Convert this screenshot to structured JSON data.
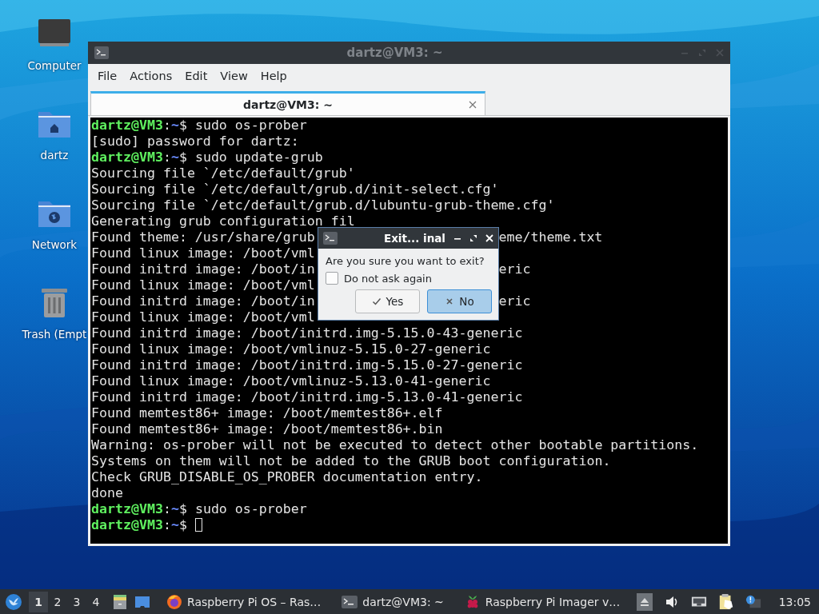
{
  "desktop_icons": [
    {
      "label": "Computer",
      "kind": "computer"
    },
    {
      "label": "dartz",
      "kind": "home"
    },
    {
      "label": "Network",
      "kind": "network"
    },
    {
      "label": "Trash (Empt",
      "kind": "trash"
    }
  ],
  "terminal_window": {
    "title": "dartz@VM3: ~",
    "menu": [
      "File",
      "Actions",
      "Edit",
      "View",
      "Help"
    ],
    "tabs": [
      {
        "label": "dartz@VM3: ~",
        "selected": true
      }
    ],
    "lines": [
      {
        "kind": "prompt",
        "parts": [
          "dartz@VM3",
          ":",
          "~",
          "$ sudo os-prober"
        ]
      },
      {
        "kind": "output",
        "text": "[sudo] password for dartz:"
      },
      {
        "kind": "prompt",
        "parts": [
          "dartz@VM3",
          ":",
          "~",
          "$ sudo update-grub"
        ]
      },
      {
        "kind": "output",
        "text": "Sourcing file `/etc/default/grub'"
      },
      {
        "kind": "output",
        "text": "Sourcing file `/etc/default/grub.d/init-select.cfg'"
      },
      {
        "kind": "output",
        "text": "Sourcing file `/etc/default/grub.d/lubuntu-grub-theme.cfg'"
      },
      {
        "kind": "output",
        "text": "Generating grub configuration fil"
      },
      {
        "kind": "split",
        "left": "Found theme: /usr/share/grub",
        "right": "eme/theme.txt"
      },
      {
        "kind": "output",
        "text": "Found linux image: /boot/vml"
      },
      {
        "kind": "split",
        "left": "Found initrd image: /boot/in",
        "right": "eric"
      },
      {
        "kind": "output",
        "text": "Found linux image: /boot/vml"
      },
      {
        "kind": "split",
        "left": "Found initrd image: /boot/in",
        "right": "eric"
      },
      {
        "kind": "output",
        "text": "Found linux image: /boot/vml"
      },
      {
        "kind": "output",
        "text": "Found initrd image: /boot/initrd.img-5.15.0-43-generic"
      },
      {
        "kind": "output",
        "text": "Found linux image: /boot/vmlinuz-5.15.0-27-generic"
      },
      {
        "kind": "output",
        "text": "Found initrd image: /boot/initrd.img-5.15.0-27-generic"
      },
      {
        "kind": "output",
        "text": "Found linux image: /boot/vmlinuz-5.13.0-41-generic"
      },
      {
        "kind": "output",
        "text": "Found initrd image: /boot/initrd.img-5.13.0-41-generic"
      },
      {
        "kind": "output",
        "text": "Found memtest86+ image: /boot/memtest86+.elf"
      },
      {
        "kind": "output",
        "text": "Found memtest86+ image: /boot/memtest86+.bin"
      },
      {
        "kind": "output",
        "text": "Warning: os-prober will not be executed to detect other bootable partitions."
      },
      {
        "kind": "output",
        "text": "Systems on them will not be added to the GRUB boot configuration."
      },
      {
        "kind": "output",
        "text": "Check GRUB_DISABLE_OS_PROBER documentation entry."
      },
      {
        "kind": "output",
        "text": "done"
      },
      {
        "kind": "prompt",
        "parts": [
          "dartz@VM3",
          ":",
          "~",
          "$ sudo os-prober"
        ]
      },
      {
        "kind": "cursor",
        "parts": [
          "dartz@VM3",
          ":",
          "~",
          "$ "
        ]
      }
    ]
  },
  "dialog": {
    "title": "Exit... inal",
    "message": "Are you sure you want to exit?",
    "checkbox": {
      "label": "Do not ask again",
      "checked": false
    },
    "buttons": [
      {
        "label": "Yes",
        "kind": "check",
        "selected": false
      },
      {
        "label": "No",
        "kind": "cross",
        "selected": true
      }
    ]
  },
  "taskbar": {
    "workspaces": [
      {
        "label": "1",
        "selected": true
      },
      {
        "label": "2",
        "selected": false
      },
      {
        "label": "3",
        "selected": false
      },
      {
        "label": "4",
        "selected": false
      }
    ],
    "tasks": [
      {
        "label": "Raspberry Pi OS – Ras…",
        "kind": "browser"
      },
      {
        "label": "dartz@VM3: ~",
        "kind": "terminal"
      },
      {
        "label": "Raspberry Pi Imager v…",
        "kind": "raspberry"
      }
    ],
    "clock": "13:05"
  }
}
